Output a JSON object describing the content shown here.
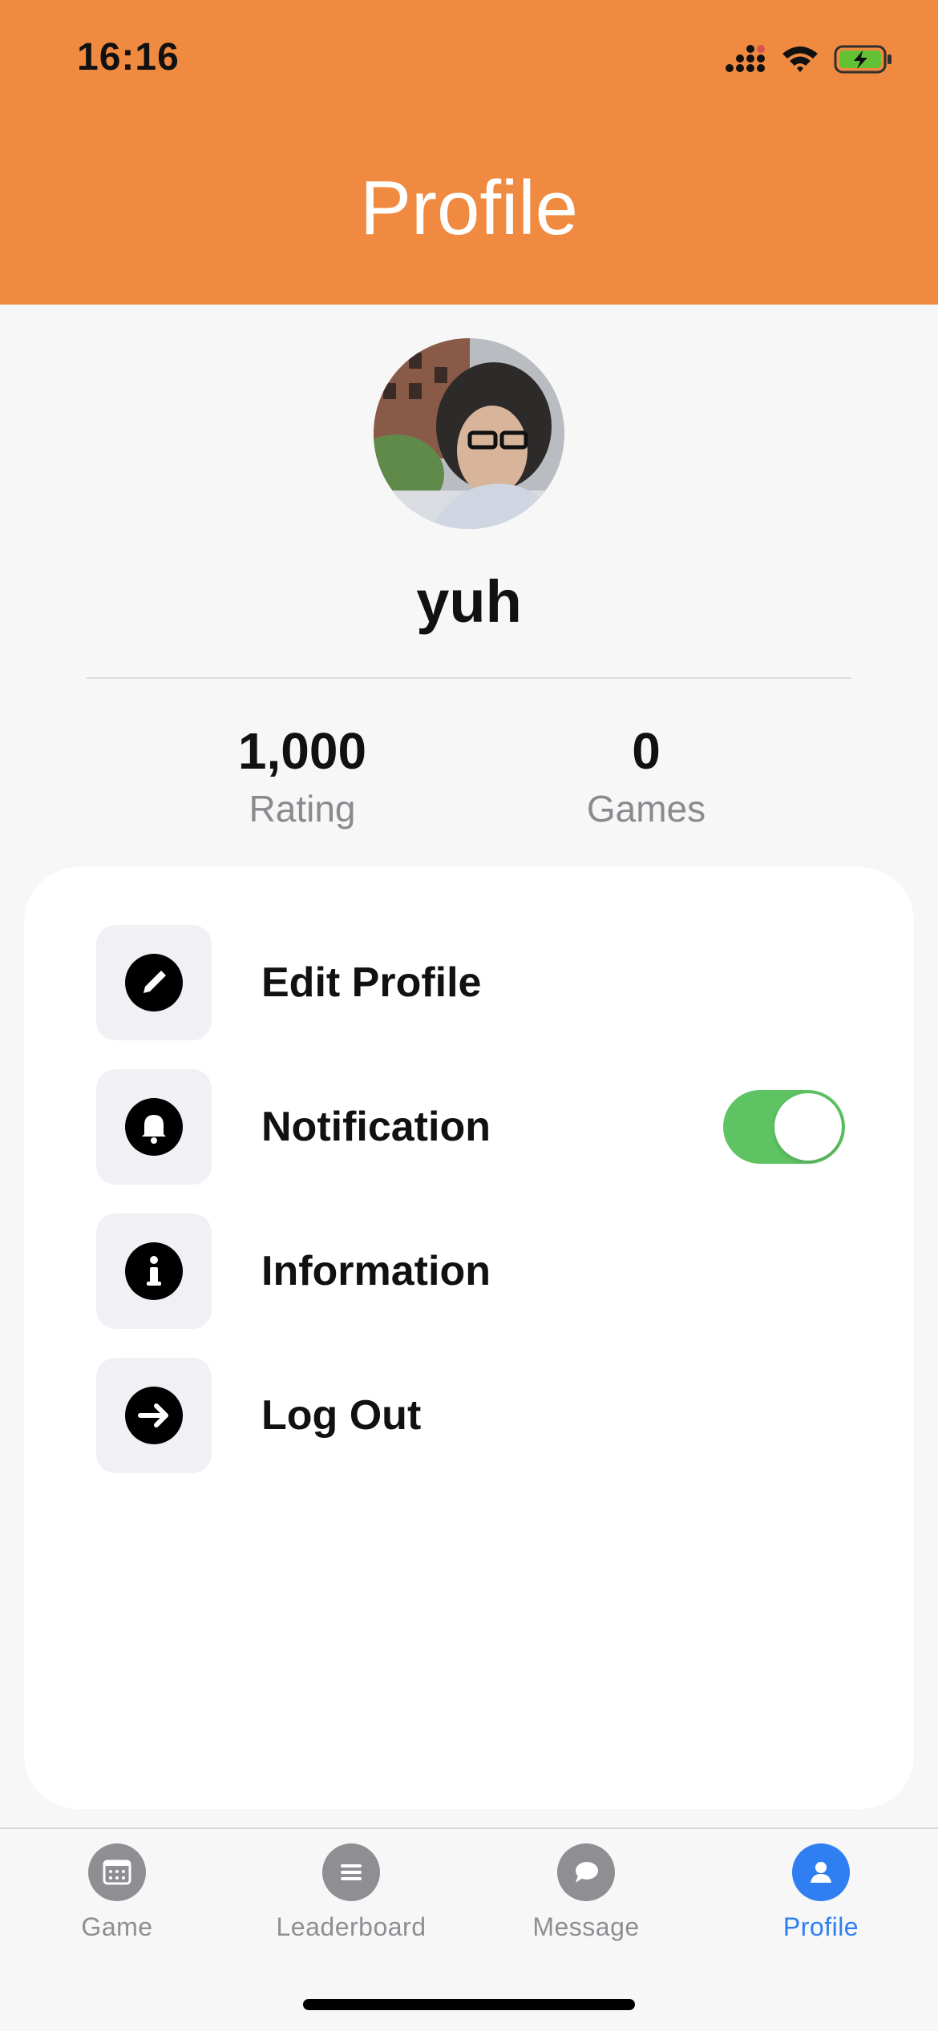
{
  "status_bar": {
    "time": "16:16",
    "icons": [
      "cellular-signal-icon",
      "wifi-icon",
      "battery-charging-icon"
    ]
  },
  "header": {
    "title": "Profile",
    "background": "#f08a40"
  },
  "profile": {
    "avatar": "avatar-photo",
    "username": "yuh",
    "stats": [
      {
        "value": "1,000",
        "label": "Rating"
      },
      {
        "value": "0",
        "label": "Games"
      }
    ]
  },
  "menu": {
    "items": [
      {
        "label": "Edit Profile",
        "icon": "pencil-icon"
      },
      {
        "label": "Notification",
        "icon": "bell-icon",
        "toggle": true
      },
      {
        "label": "Information",
        "icon": "info-icon"
      },
      {
        "label": "Log Out",
        "icon": "arrow-right-icon"
      }
    ]
  },
  "tabbar": {
    "items": [
      {
        "label": "Game",
        "icon": "calendar-icon"
      },
      {
        "label": "Leaderboard",
        "icon": "list-icon"
      },
      {
        "label": "Message",
        "icon": "chat-bubble-icon"
      },
      {
        "label": "Profile",
        "icon": "person-icon",
        "active": true
      }
    ],
    "active_color": "#2f7ff2",
    "inactive_color": "#8e8e93"
  },
  "colors": {
    "toggle_on": "#5ec463"
  }
}
